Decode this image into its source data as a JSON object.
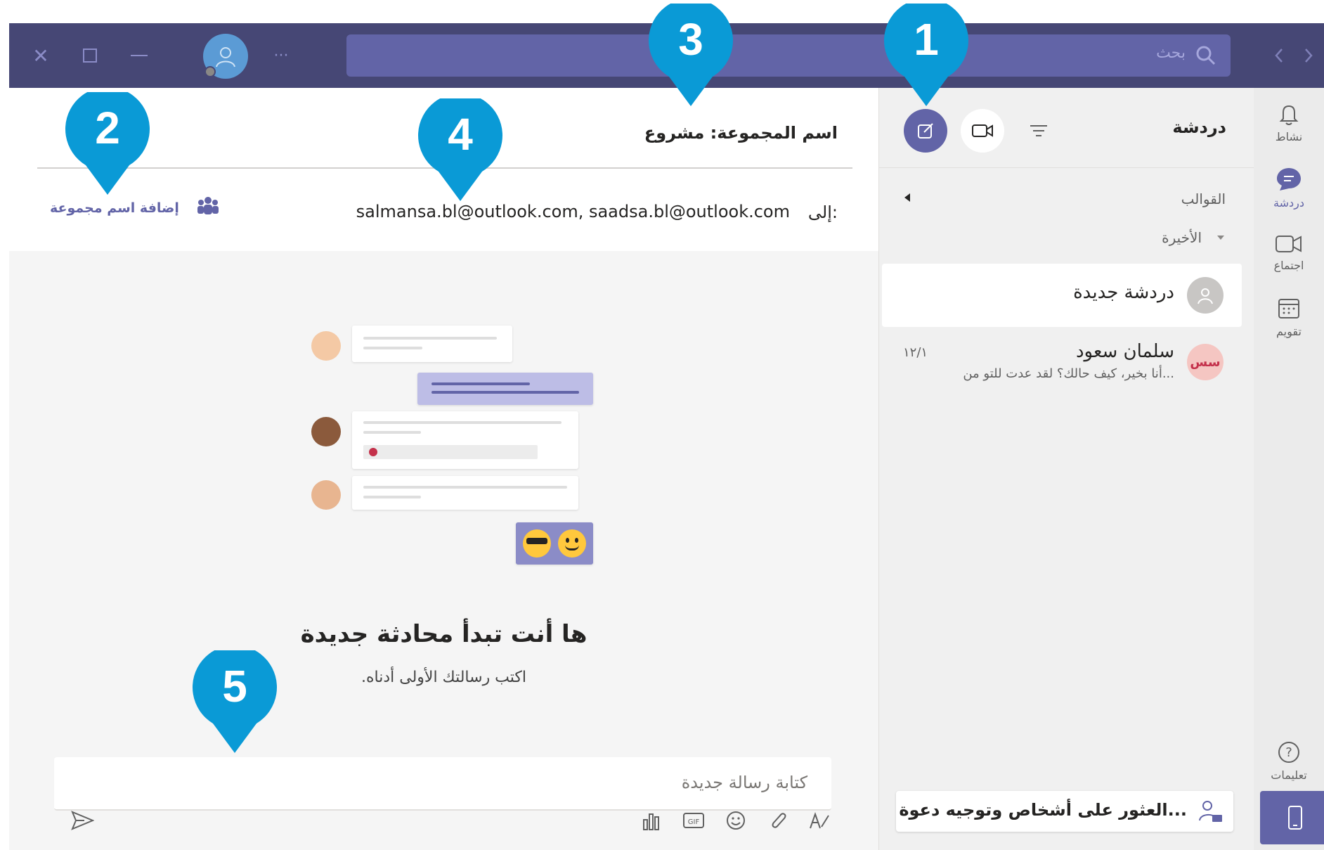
{
  "titlebar": {
    "search_placeholder": "بحث"
  },
  "rail": {
    "items": [
      {
        "label": "نشاط",
        "icon": "bell-icon"
      },
      {
        "label": "دردشة",
        "icon": "chat-icon"
      },
      {
        "label": "اجتماع",
        "icon": "video-icon"
      },
      {
        "label": "تقويم",
        "icon": "calendar-icon"
      },
      {
        "label": "تعليمات",
        "icon": "help-icon"
      }
    ]
  },
  "chat_list": {
    "title": "دردشة",
    "templates_label": "القوالب",
    "recent_label": "الأخيرة",
    "chats": [
      {
        "name": "دردشة جديدة",
        "preview": "",
        "date": ""
      },
      {
        "name": "سلمان سعود",
        "preview": "أنا بخير، كيف حالك؟ لقد عدت للتو من...",
        "date": "١٢/١",
        "avatar_text": "سس"
      }
    ],
    "invite_label": "العثور على أشخاص وتوجيه دعوة..."
  },
  "conversation": {
    "group_title": "اسم المجموعة: مشروع",
    "to_label": "إلى:",
    "recipients": "salmansa.bl@outlook.com, saadsa.bl@outlook.com",
    "add_group_name": "إضافة اسم مجموعة",
    "hero_title": "ها أنت تبدأ محادثة جديدة",
    "hero_subtitle": "اكتب رسالتك الأولى أدناه.",
    "compose_placeholder": "كتابة رسالة جديدة"
  },
  "markers": [
    "1",
    "2",
    "3",
    "4",
    "5"
  ],
  "colors": {
    "titlebar": "#464775",
    "accent": "#6264a7",
    "marker": "#0a9ad6"
  }
}
